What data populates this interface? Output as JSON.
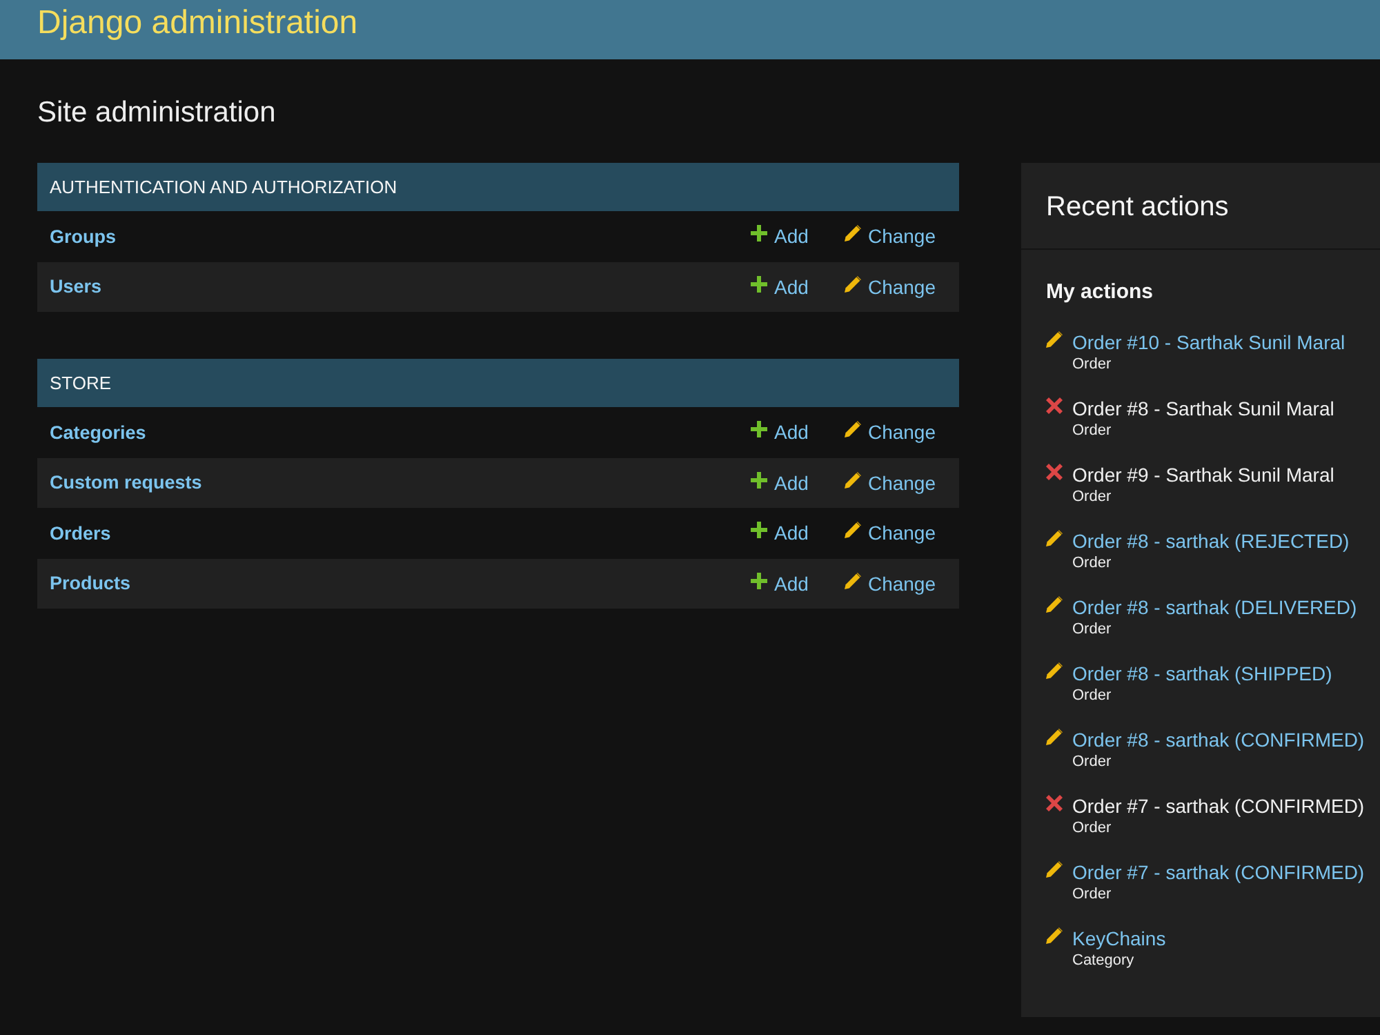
{
  "header": {
    "title": "Django administration"
  },
  "page_title": "Site administration",
  "modules": [
    {
      "caption": "AUTHENTICATION AND AUTHORIZATION",
      "models": [
        {
          "name": "Groups",
          "add": "Add",
          "change": "Change"
        },
        {
          "name": "Users",
          "add": "Add",
          "change": "Change"
        }
      ]
    },
    {
      "caption": "STORE",
      "models": [
        {
          "name": "Categories",
          "add": "Add",
          "change": "Change"
        },
        {
          "name": "Custom requests",
          "add": "Add",
          "change": "Change"
        },
        {
          "name": "Orders",
          "add": "Add",
          "change": "Change"
        },
        {
          "name": "Products",
          "add": "Add",
          "change": "Change"
        }
      ]
    }
  ],
  "recent_actions": {
    "title": "Recent actions",
    "subtitle": "My actions",
    "actions": [
      {
        "kind": "change",
        "label": "Order #10 - Sarthak Sunil Maral",
        "type": "Order"
      },
      {
        "kind": "deletion",
        "label": "Order #8 - Sarthak Sunil Maral",
        "type": "Order"
      },
      {
        "kind": "deletion",
        "label": "Order #9 - Sarthak Sunil Maral",
        "type": "Order"
      },
      {
        "kind": "change",
        "label": "Order #8 - sarthak (REJECTED)",
        "type": "Order"
      },
      {
        "kind": "change",
        "label": "Order #8 - sarthak (DELIVERED)",
        "type": "Order"
      },
      {
        "kind": "change",
        "label": "Order #8 - sarthak (SHIPPED)",
        "type": "Order"
      },
      {
        "kind": "change",
        "label": "Order #8 - sarthak (CONFIRMED)",
        "type": "Order"
      },
      {
        "kind": "deletion",
        "label": "Order #7 - sarthak (CONFIRMED)",
        "type": "Order"
      },
      {
        "kind": "change",
        "label": "Order #7 - sarthak (CONFIRMED)",
        "type": "Order"
      },
      {
        "kind": "change",
        "label": "KeyChains",
        "type": "Category"
      }
    ]
  }
}
